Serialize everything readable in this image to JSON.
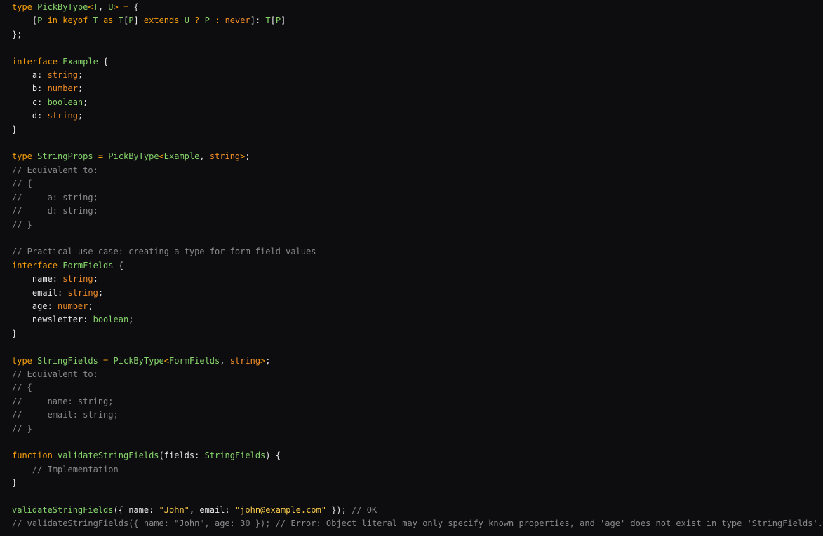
{
  "colors": {
    "background": "#0d0d10",
    "keyword": "#f59e0b",
    "type_name": "#86d46a",
    "builtin_type": "#f08c28",
    "string_literal": "#f7c948",
    "comment": "#8a8a8a",
    "text": "#e6e6e6"
  },
  "lines": [
    [
      [
        "kw",
        "type "
      ],
      [
        "ty",
        "PickByType"
      ],
      [
        "op",
        "<"
      ],
      [
        "ty",
        "T"
      ],
      [
        "pu",
        ", "
      ],
      [
        "ty",
        "U"
      ],
      [
        "op",
        "> = "
      ],
      [
        "pu",
        "{"
      ]
    ],
    [
      [
        "pu",
        "    ["
      ],
      [
        "ty",
        "P"
      ],
      [
        "kw",
        " in keyof "
      ],
      [
        "ty",
        "T"
      ],
      [
        "kw",
        " as "
      ],
      [
        "ty",
        "T"
      ],
      [
        "pu",
        "["
      ],
      [
        "ty",
        "P"
      ],
      [
        "pu",
        "]"
      ],
      [
        "kw",
        " extends "
      ],
      [
        "ty",
        "U"
      ],
      [
        "op",
        " ? "
      ],
      [
        "ty",
        "P"
      ],
      [
        "op",
        " : "
      ],
      [
        "bt",
        "never"
      ],
      [
        "pu",
        "]: "
      ],
      [
        "ty",
        "T"
      ],
      [
        "pu",
        "["
      ],
      [
        "ty",
        "P"
      ],
      [
        "pu",
        "]"
      ]
    ],
    [
      [
        "pu",
        "};"
      ]
    ],
    [],
    [
      [
        "kw",
        "interface "
      ],
      [
        "ty",
        "Example"
      ],
      [
        "pu",
        " {"
      ]
    ],
    [
      [
        "id",
        "    a: "
      ],
      [
        "bt",
        "string"
      ],
      [
        "pu",
        ";"
      ]
    ],
    [
      [
        "id",
        "    b: "
      ],
      [
        "bt",
        "number"
      ],
      [
        "pu",
        ";"
      ]
    ],
    [
      [
        "id",
        "    c: "
      ],
      [
        "bo",
        "boolean"
      ],
      [
        "pu",
        ";"
      ]
    ],
    [
      [
        "id",
        "    d: "
      ],
      [
        "bt",
        "string"
      ],
      [
        "pu",
        ";"
      ]
    ],
    [
      [
        "pu",
        "}"
      ]
    ],
    [],
    [
      [
        "kw",
        "type "
      ],
      [
        "ty",
        "StringProps"
      ],
      [
        "op",
        " = "
      ],
      [
        "ty",
        "PickByType"
      ],
      [
        "op",
        "<"
      ],
      [
        "ty",
        "Example"
      ],
      [
        "pu",
        ", "
      ],
      [
        "bt",
        "string"
      ],
      [
        "op",
        ">"
      ],
      [
        "pu",
        ";"
      ]
    ],
    [
      [
        "cm",
        "// Equivalent to:"
      ]
    ],
    [
      [
        "cm",
        "// {"
      ]
    ],
    [
      [
        "cm",
        "//     a: string;"
      ]
    ],
    [
      [
        "cm",
        "//     d: string;"
      ]
    ],
    [
      [
        "cm",
        "// }"
      ]
    ],
    [],
    [
      [
        "cm",
        "// Practical use case: creating a type for form field values"
      ]
    ],
    [
      [
        "kw",
        "interface "
      ],
      [
        "ty",
        "FormFields"
      ],
      [
        "pu",
        " {"
      ]
    ],
    [
      [
        "id",
        "    name: "
      ],
      [
        "bt",
        "string"
      ],
      [
        "pu",
        ";"
      ]
    ],
    [
      [
        "id",
        "    email: "
      ],
      [
        "bt",
        "string"
      ],
      [
        "pu",
        ";"
      ]
    ],
    [
      [
        "id",
        "    age: "
      ],
      [
        "bt",
        "number"
      ],
      [
        "pu",
        ";"
      ]
    ],
    [
      [
        "id",
        "    newsletter: "
      ],
      [
        "bo",
        "boolean"
      ],
      [
        "pu",
        ";"
      ]
    ],
    [
      [
        "pu",
        "}"
      ]
    ],
    [],
    [
      [
        "kw",
        "type "
      ],
      [
        "ty",
        "StringFields"
      ],
      [
        "op",
        " = "
      ],
      [
        "ty",
        "PickByType"
      ],
      [
        "op",
        "<"
      ],
      [
        "ty",
        "FormFields"
      ],
      [
        "pu",
        ", "
      ],
      [
        "bt",
        "string"
      ],
      [
        "op",
        ">"
      ],
      [
        "pu",
        ";"
      ]
    ],
    [
      [
        "cm",
        "// Equivalent to:"
      ]
    ],
    [
      [
        "cm",
        "// {"
      ]
    ],
    [
      [
        "cm",
        "//     name: string;"
      ]
    ],
    [
      [
        "cm",
        "//     email: string;"
      ]
    ],
    [
      [
        "cm",
        "// }"
      ]
    ],
    [],
    [
      [
        "kw",
        "function "
      ],
      [
        "fn",
        "validateStringFields"
      ],
      [
        "pu",
        "("
      ],
      [
        "id",
        "fields"
      ],
      [
        "pu",
        ": "
      ],
      [
        "ty",
        "StringFields"
      ],
      [
        "pu",
        ") {"
      ]
    ],
    [
      [
        "cm",
        "    // Implementation"
      ]
    ],
    [
      [
        "pu",
        "}"
      ]
    ],
    [],
    [
      [
        "fn",
        "validateStringFields"
      ],
      [
        "pu",
        "({ "
      ],
      [
        "id",
        "name"
      ],
      [
        "pu",
        ": "
      ],
      [
        "st",
        "\"John\""
      ],
      [
        "pu",
        ", "
      ],
      [
        "id",
        "email"
      ],
      [
        "pu",
        ": "
      ],
      [
        "st",
        "\"john@example.com\""
      ],
      [
        "pu",
        " }); "
      ],
      [
        "cm",
        "// OK"
      ]
    ],
    [
      [
        "cm",
        "// validateStringFields({ name: \"John\", age: 30 }); // Error: Object literal may only specify known properties, and 'age' does not exist in type 'StringFields'."
      ]
    ]
  ]
}
